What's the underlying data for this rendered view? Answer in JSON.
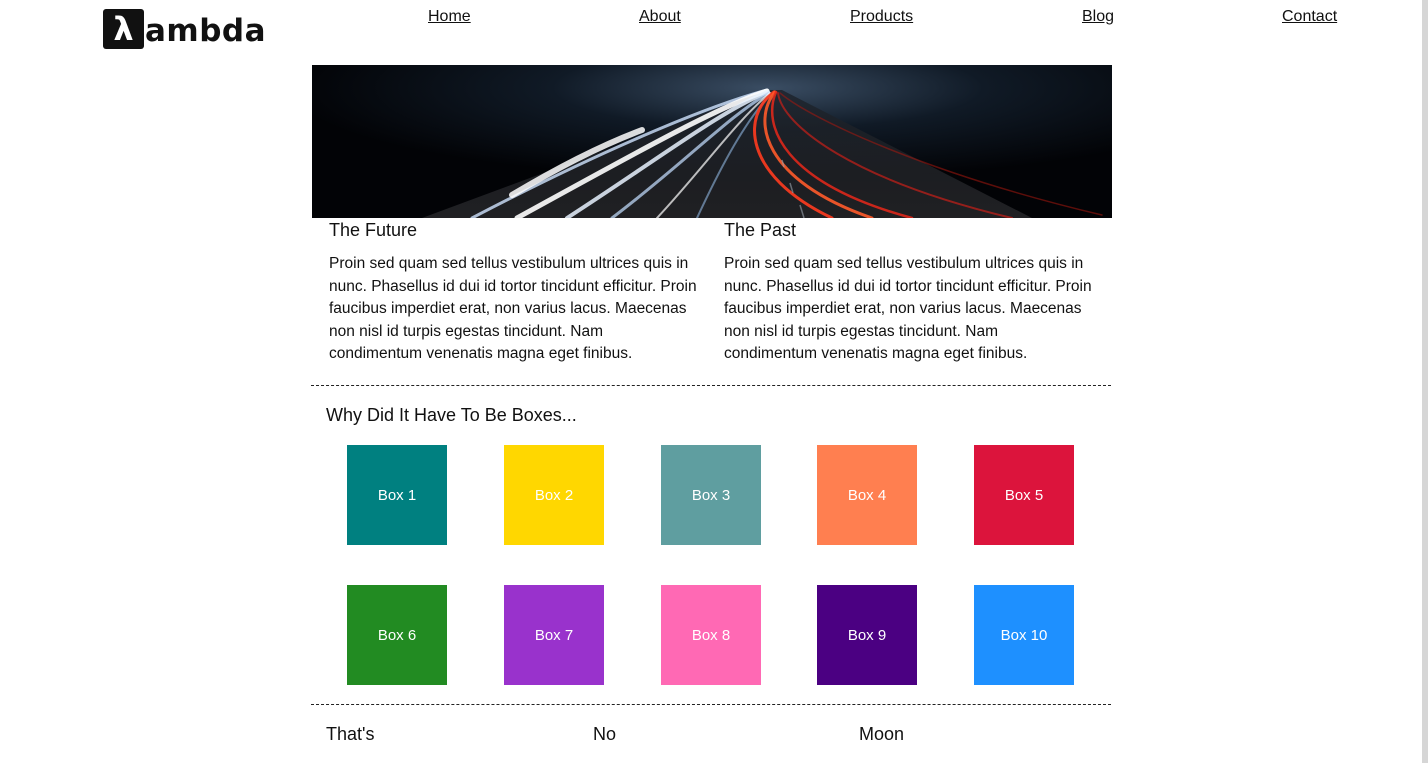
{
  "header": {
    "logo_mark": "λ",
    "logo_text": "ambda",
    "nav": [
      "Home",
      "About",
      "Products",
      "Blog",
      "Contact"
    ]
  },
  "columns": [
    {
      "title": "The Future",
      "text": "Proin sed quam sed tellus vestibulum ultrices quis in nunc. Phasellus id dui id tortor tincidunt efficitur. Proin faucibus imperdiet erat, non varius lacus. Maecenas non nisl id turpis egestas tincidunt. Nam condimentum venenatis magna eget finibus."
    },
    {
      "title": "The Past",
      "text": "Proin sed quam sed tellus vestibulum ultrices quis in nunc. Phasellus id dui id tortor tincidunt efficitur. Proin faucibus imperdiet erat, non varius lacus. Maecenas non nisl id turpis egestas tincidunt. Nam condimentum venenatis magna eget finibus."
    }
  ],
  "boxes_section": {
    "title": "Why Did It Have To Be Boxes...",
    "boxes": [
      {
        "label": "Box 1",
        "color": "#008080"
      },
      {
        "label": "Box 2",
        "color": "#FFD700"
      },
      {
        "label": "Box 3",
        "color": "#5F9EA0"
      },
      {
        "label": "Box 4",
        "color": "#FF7F50"
      },
      {
        "label": "Box 5",
        "color": "#DC143C"
      },
      {
        "label": "Box 6",
        "color": "#228B22"
      },
      {
        "label": "Box 7",
        "color": "#9932CC"
      },
      {
        "label": "Box 8",
        "color": "#FF69B4"
      },
      {
        "label": "Box 9",
        "color": "#4B0082"
      },
      {
        "label": "Box 10",
        "color": "#1E90FF"
      }
    ]
  },
  "footer": {
    "words": [
      "That's",
      "No",
      "Moon"
    ]
  }
}
